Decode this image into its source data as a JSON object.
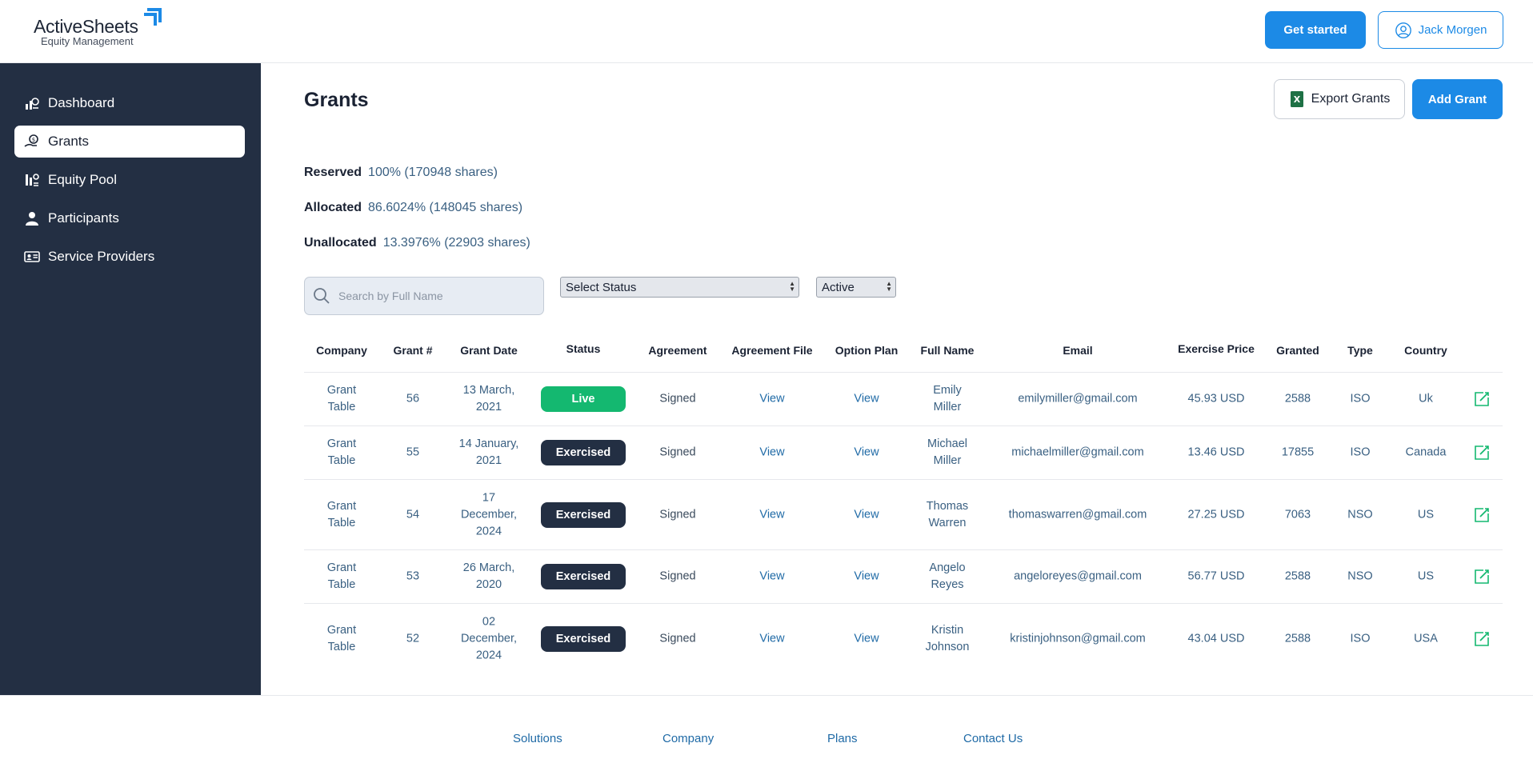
{
  "brand": {
    "name": "ActiveSheets",
    "subtitle": "Equity Management"
  },
  "header": {
    "get_started": "Get started",
    "user_name": "Jack Morgen"
  },
  "sidebar": {
    "items": [
      {
        "label": "Dashboard",
        "icon": "dashboard-icon",
        "active": false
      },
      {
        "label": "Grants",
        "icon": "grants-icon",
        "active": true
      },
      {
        "label": "Equity Pool",
        "icon": "equity-pool-icon",
        "active": false
      },
      {
        "label": "Participants",
        "icon": "user-icon",
        "active": false
      },
      {
        "label": "Service Providers",
        "icon": "id-card-icon",
        "active": false
      }
    ]
  },
  "main": {
    "title": "Grants",
    "export_label": "Export Grants",
    "add_label": "Add Grant",
    "stats": [
      {
        "label": "Reserved",
        "value": "100% (170948 shares)"
      },
      {
        "label": "Allocated",
        "value": "86.6024% (148045 shares)"
      },
      {
        "label": "Unallocated",
        "value": "13.3976% (22903 shares)"
      }
    ],
    "search_placeholder": "Search by Full Name",
    "status_select": "Select Status",
    "active_select": "Active",
    "columns": [
      "Company",
      "Grant #",
      "Grant Date",
      "Status",
      "Agreement",
      "Agreement File",
      "Option Plan",
      "Full Name",
      "Email",
      "Exercise Price",
      "Granted",
      "Type",
      "Country"
    ],
    "rows": [
      {
        "company": "Grant Table",
        "grant_no": "56",
        "date": "13 March, 2021",
        "status": "Live",
        "agreement": "Signed",
        "file": "View",
        "plan": "View",
        "name": "Emily Miller",
        "email": "emilymiller@gmail.com",
        "price": "45.93 USD",
        "granted": "2588",
        "type": "ISO",
        "country": "Uk"
      },
      {
        "company": "Grant Table",
        "grant_no": "55",
        "date": "14 January, 2021",
        "status": "Exercised",
        "agreement": "Signed",
        "file": "View",
        "plan": "View",
        "name": "Michael Miller",
        "email": "michaelmiller@gmail.com",
        "price": "13.46 USD",
        "granted": "17855",
        "type": "ISO",
        "country": "Canada"
      },
      {
        "company": "Grant Table",
        "grant_no": "54",
        "date": "17 December, 2024",
        "status": "Exercised",
        "agreement": "Signed",
        "file": "View",
        "plan": "View",
        "name": "Thomas Warren",
        "email": "thomaswarren@gmail.com",
        "price": "27.25 USD",
        "granted": "7063",
        "type": "NSO",
        "country": "US"
      },
      {
        "company": "Grant Table",
        "grant_no": "53",
        "date": "26 March, 2020",
        "status": "Exercised",
        "agreement": "Signed",
        "file": "View",
        "plan": "View",
        "name": "Angelo Reyes",
        "email": "angeloreyes@gmail.com",
        "price": "56.77 USD",
        "granted": "2588",
        "type": "NSO",
        "country": "US"
      },
      {
        "company": "Grant Table",
        "grant_no": "52",
        "date": "02 December, 2024",
        "status": "Exercised",
        "agreement": "Signed",
        "file": "View",
        "plan": "View",
        "name": "Kristin Johnson",
        "email": "kristinjohnson@gmail.com",
        "price": "43.04 USD",
        "granted": "2588",
        "type": "ISO",
        "country": "USA"
      }
    ]
  },
  "footer": {
    "links": [
      "Solutions",
      "Company",
      "Plans",
      "Contact Us"
    ]
  },
  "colors": {
    "accent": "#1c8ae6",
    "sidebar": "#232f43",
    "live": "#14b870",
    "exercised": "#232f43",
    "edit": "#14b870"
  }
}
